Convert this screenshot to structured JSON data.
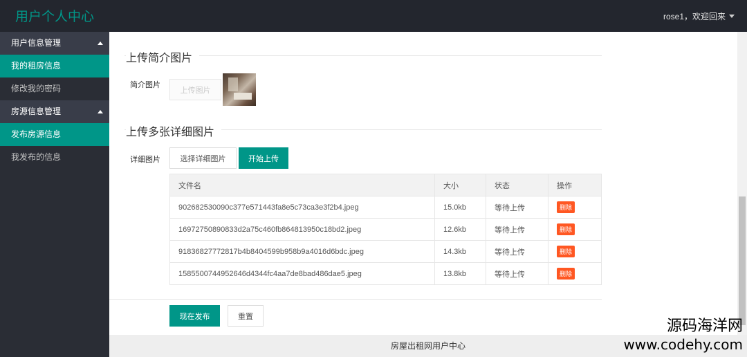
{
  "header": {
    "logo": "用户个人中心",
    "user_greeting": "rose1，欢迎回来"
  },
  "sidebar": {
    "group1": "用户信息管理",
    "group1_items": [
      "我的租房信息",
      "修改我的密码"
    ],
    "group2": "房源信息管理",
    "group2_items": [
      "发布房源信息",
      "我发布的信息"
    ]
  },
  "intro_section": {
    "title": "上传简介图片",
    "field_label": "简介图片",
    "upload_button": "上传图片"
  },
  "detail_section": {
    "title": "上传多张详细图片",
    "field_label": "详细图片",
    "select_button": "选择详细图片",
    "start_button": "开始上传"
  },
  "file_table": {
    "headers": [
      "文件名",
      "大小",
      "状态",
      "操作"
    ],
    "rows": [
      {
        "name": "902682530090c377e571443fa8e5c73ca3e3f2b4.jpeg",
        "size": "15.0kb",
        "status": "等待上传",
        "action": "删除"
      },
      {
        "name": "16972750890833d2a75c460fb864813950c18bd2.jpeg",
        "size": "12.6kb",
        "status": "等待上传",
        "action": "删除"
      },
      {
        "name": "91836827772817b4b8404599b958b9a4016d6bdc.jpeg",
        "size": "14.3kb",
        "status": "等待上传",
        "action": "删除"
      },
      {
        "name": "1585500744952646d4344fc4aa7de8bad486dae5.jpeg",
        "size": "13.8kb",
        "status": "等待上传",
        "action": "删除"
      }
    ]
  },
  "form_actions": {
    "publish": "现在发布",
    "reset": "重置"
  },
  "footer": {
    "text": "房屋出租网用户中心"
  },
  "watermark": {
    "line1": "源码海洋网",
    "line2": "www.codehy.com"
  },
  "colors": {
    "accent": "#009688",
    "header_bg": "#23262e",
    "danger": "#ff5722"
  }
}
